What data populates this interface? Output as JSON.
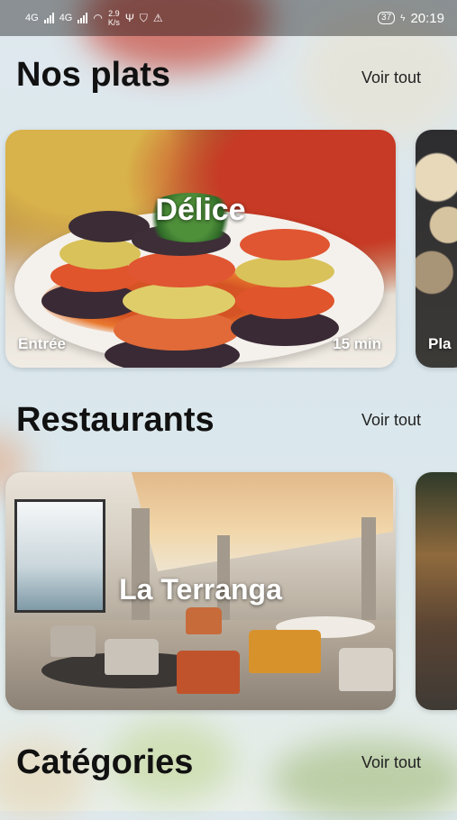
{
  "status_bar": {
    "network_1": "4G",
    "network_2": "4G",
    "speed_value": "2.9",
    "speed_unit": "K/s",
    "battery": "37",
    "time": "20:19"
  },
  "sections": {
    "dishes": {
      "title": "Nos plats",
      "see_all": "Voir tout"
    },
    "restaurants": {
      "title": "Restaurants",
      "see_all": "Voir tout"
    },
    "categories": {
      "title": "Catégories",
      "see_all": "Voir tout"
    }
  },
  "dishes": [
    {
      "name": "Délice",
      "category": "Entrée",
      "time": "15 min"
    },
    {
      "name": "",
      "category": "Pla",
      "time": ""
    }
  ],
  "restaurants": [
    {
      "name": "La Terranga"
    },
    {
      "name": ""
    }
  ],
  "colors": {
    "title_text": "#111111",
    "card_text": "#ffffff"
  }
}
